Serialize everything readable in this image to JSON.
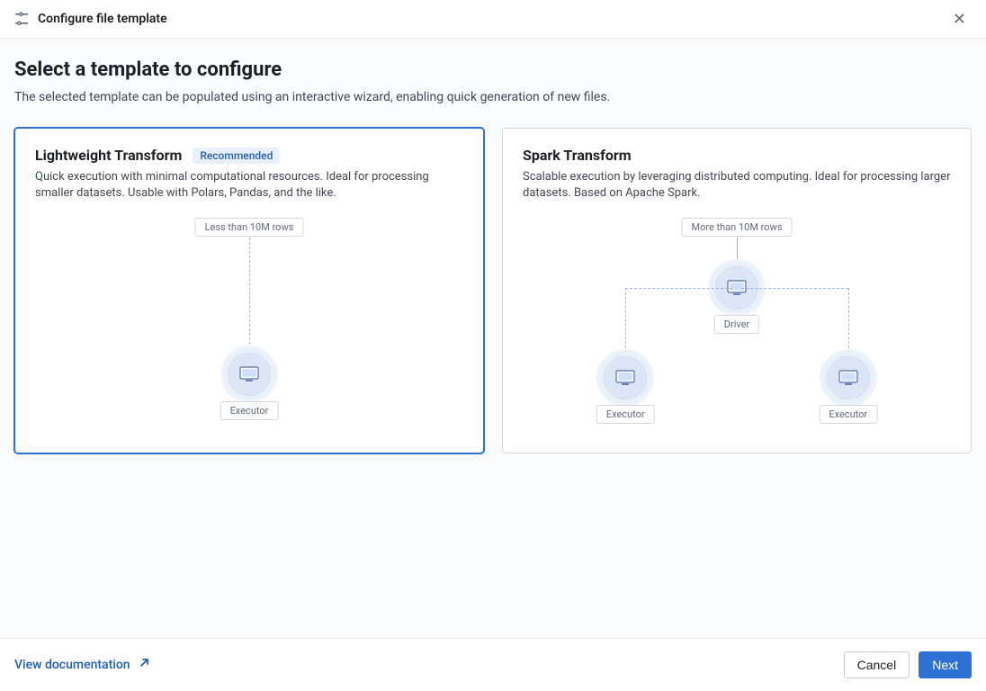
{
  "header": {
    "title": "Configure file template"
  },
  "page": {
    "title": "Select a template to configure",
    "subtitle": "The selected template can be populated using an interactive wizard, enabling quick generation of new files."
  },
  "templates": {
    "lightweight": {
      "title": "Lightweight Transform",
      "badge": "Recommended",
      "description": "Quick execution with minimal computational resources. Ideal for processing smaller datasets. Usable with Polars, Pandas, and the like.",
      "size_hint": "Less than 10M rows",
      "executor_label": "Executor",
      "selected": true
    },
    "spark": {
      "title": "Spark Transform",
      "description": "Scalable execution by leveraging distributed computing. Ideal for processing larger datasets. Based on Apache Spark.",
      "size_hint": "More than 10M rows",
      "driver_label": "Driver",
      "executor_label_left": "Executor",
      "executor_label_right": "Executor",
      "selected": false
    }
  },
  "footer": {
    "doc_link": "View documentation",
    "cancel": "Cancel",
    "next": "Next"
  }
}
